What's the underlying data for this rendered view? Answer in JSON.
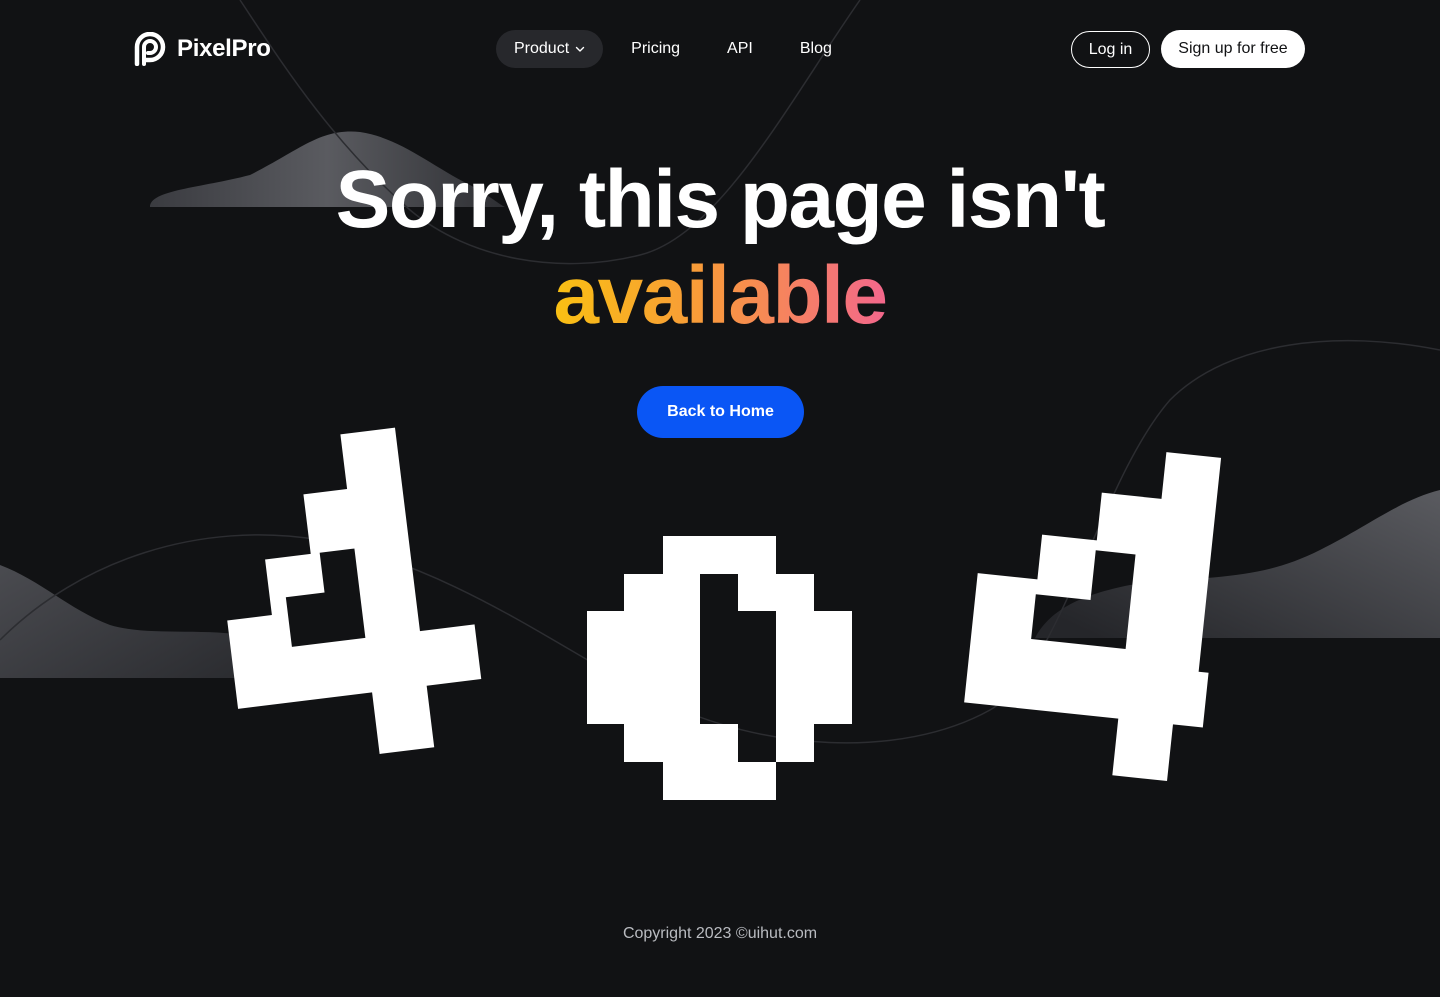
{
  "brand": {
    "name": "PixelPro",
    "icon": "pixelpro-logo-icon"
  },
  "nav": {
    "items": [
      {
        "label": "Product",
        "icon": "chevron-down-icon",
        "active": true
      },
      {
        "label": "Pricing"
      },
      {
        "label": "API"
      },
      {
        "label": "Blog"
      }
    ],
    "login_label": "Log in",
    "signup_label": "Sign up for free"
  },
  "hero": {
    "title_line1": "Sorry, this page isn't",
    "title_line2": "available",
    "cta_label": "Back to Home"
  },
  "error_art": {
    "digits": [
      "4",
      "0",
      "4"
    ]
  },
  "footer": {
    "copyright": "Copyright 2023 ©uihut.com"
  },
  "colors": {
    "background": "#111214",
    "primary_button": "#0a56f5",
    "gradient_start": "#f9c013",
    "gradient_mid": "#f89a3a",
    "gradient_end": "#f3678c",
    "nav_pill": "#27282c",
    "text": "#ffffff",
    "footer_text": "#b9bbc0"
  }
}
